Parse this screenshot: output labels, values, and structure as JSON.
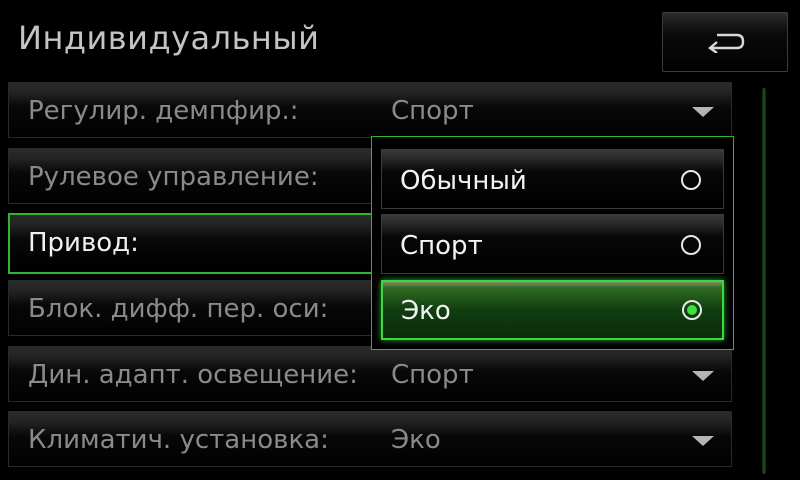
{
  "header": {
    "title": "Индивидуальный",
    "back_icon": "return-arrow-icon"
  },
  "settings": {
    "rows": [
      {
        "label": "Регулир. демпфир.:",
        "value": "Спорт",
        "has_dropdown": true
      },
      {
        "label": "Рулевое управление:",
        "value": "",
        "has_dropdown": false
      },
      {
        "label": "Привод:",
        "value": "",
        "has_dropdown": false,
        "selected": true
      },
      {
        "label": "Блок. дифф. пер. оси:",
        "value": "",
        "has_dropdown": false
      },
      {
        "label": "Дин. адапт. освещение:",
        "value": "Спорт",
        "has_dropdown": true
      },
      {
        "label": "Климатич. установка:",
        "value": "Эко",
        "has_dropdown": true
      }
    ]
  },
  "popup": {
    "options": [
      {
        "label": "Обычный",
        "checked": false
      },
      {
        "label": "Спорт",
        "checked": false
      },
      {
        "label": "Эко",
        "checked": true
      }
    ]
  },
  "colors": {
    "accent_green": "#2fb52f",
    "active_green": "#3fd83f",
    "background": "#000000",
    "text_dim": "#8a8a8a",
    "text_bright": "#f0f0f0"
  }
}
